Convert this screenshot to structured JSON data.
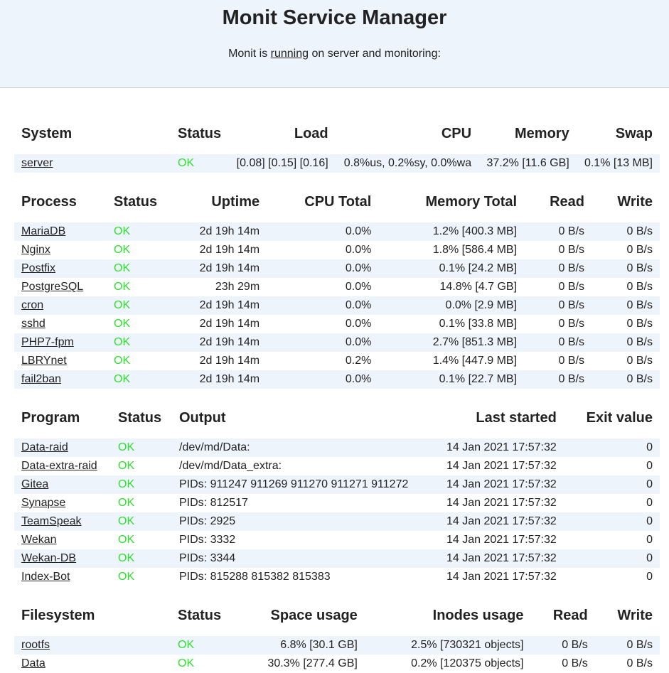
{
  "header": {
    "title": "Monit Service Manager",
    "status_prefix": "Monit is ",
    "status_link": "running",
    "status_suffix": " on server and monitoring:"
  },
  "system": {
    "headers": [
      "System",
      "Status",
      "Load",
      "CPU",
      "Memory",
      "Swap"
    ],
    "rows": [
      {
        "name": "server",
        "status": "OK",
        "load": "[0.08] [0.15] [0.16]",
        "cpu": "0.8%us, 0.2%sy, 0.0%wa",
        "memory": "37.2% [11.6 GB]",
        "swap": "0.1% [13 MB]"
      }
    ]
  },
  "process": {
    "headers": [
      "Process",
      "Status",
      "Uptime",
      "CPU Total",
      "Memory Total",
      "Read",
      "Write"
    ],
    "rows": [
      {
        "name": "MariaDB",
        "status": "OK",
        "uptime": "2d 19h 14m",
        "cpu": "0.0%",
        "mem": "1.2% [400.3 MB]",
        "read": "0 B/s",
        "write": "0 B/s"
      },
      {
        "name": "Nginx",
        "status": "OK",
        "uptime": "2d 19h 14m",
        "cpu": "0.0%",
        "mem": "1.8% [586.4 MB]",
        "read": "0 B/s",
        "write": "0 B/s"
      },
      {
        "name": "Postfix",
        "status": "OK",
        "uptime": "2d 19h 14m",
        "cpu": "0.0%",
        "mem": "0.1% [24.2 MB]",
        "read": "0 B/s",
        "write": "0 B/s"
      },
      {
        "name": "PostgreSQL",
        "status": "OK",
        "uptime": "23h 29m",
        "cpu": "0.0%",
        "mem": "14.8% [4.7 GB]",
        "read": "0 B/s",
        "write": "0 B/s"
      },
      {
        "name": "cron",
        "status": "OK",
        "uptime": "2d 19h 14m",
        "cpu": "0.0%",
        "mem": "0.0% [2.9 MB]",
        "read": "0 B/s",
        "write": "0 B/s"
      },
      {
        "name": "sshd",
        "status": "OK",
        "uptime": "2d 19h 14m",
        "cpu": "0.0%",
        "mem": "0.1% [33.8 MB]",
        "read": "0 B/s",
        "write": "0 B/s"
      },
      {
        "name": "PHP7-fpm",
        "status": "OK",
        "uptime": "2d 19h 14m",
        "cpu": "0.0%",
        "mem": "2.7% [851.3 MB]",
        "read": "0 B/s",
        "write": "0 B/s"
      },
      {
        "name": "LBRYnet",
        "status": "OK",
        "uptime": "2d 19h 14m",
        "cpu": "0.2%",
        "mem": "1.4% [447.9 MB]",
        "read": "0 B/s",
        "write": "0 B/s"
      },
      {
        "name": "fail2ban",
        "status": "OK",
        "uptime": "2d 19h 14m",
        "cpu": "0.0%",
        "mem": "0.1% [22.7 MB]",
        "read": "0 B/s",
        "write": "0 B/s"
      }
    ]
  },
  "program": {
    "headers": [
      "Program",
      "Status",
      "Output",
      "Last started",
      "Exit value"
    ],
    "rows": [
      {
        "name": "Data-raid",
        "status": "OK",
        "output": "/dev/md/Data:",
        "started": "14 Jan 2021 17:57:32",
        "exit": "0"
      },
      {
        "name": "Data-extra-raid",
        "status": "OK",
        "output": "/dev/md/Data_extra:",
        "started": "14 Jan 2021 17:57:32",
        "exit": "0"
      },
      {
        "name": "Gitea",
        "status": "OK",
        "output": "PIDs: 911247 911269 911270 911271 911272",
        "started": "14 Jan 2021 17:57:32",
        "exit": "0"
      },
      {
        "name": "Synapse",
        "status": "OK",
        "output": "PIDs: 812517",
        "started": "14 Jan 2021 17:57:32",
        "exit": "0"
      },
      {
        "name": "TeamSpeak",
        "status": "OK",
        "output": "PIDs: 2925",
        "started": "14 Jan 2021 17:57:32",
        "exit": "0"
      },
      {
        "name": "Wekan",
        "status": "OK",
        "output": "PIDs: 3332",
        "started": "14 Jan 2021 17:57:32",
        "exit": "0"
      },
      {
        "name": "Wekan-DB",
        "status": "OK",
        "output": "PIDs: 3344",
        "started": "14 Jan 2021 17:57:32",
        "exit": "0"
      },
      {
        "name": "Index-Bot",
        "status": "OK",
        "output": "PIDs: 815288 815382 815383",
        "started": "14 Jan 2021 17:57:32",
        "exit": "0"
      }
    ]
  },
  "filesystem": {
    "headers": [
      "Filesystem",
      "Status",
      "Space usage",
      "Inodes usage",
      "Read",
      "Write"
    ],
    "rows": [
      {
        "name": "rootfs",
        "status": "OK",
        "space": "6.8% [30.1 GB]",
        "inodes": "2.5% [730321 objects]",
        "read": "0 B/s",
        "write": "0 B/s"
      },
      {
        "name": "Data",
        "status": "OK",
        "space": "30.3% [277.4 GB]",
        "inodes": "0.2% [120375 objects]",
        "read": "0 B/s",
        "write": "0 B/s"
      }
    ]
  }
}
